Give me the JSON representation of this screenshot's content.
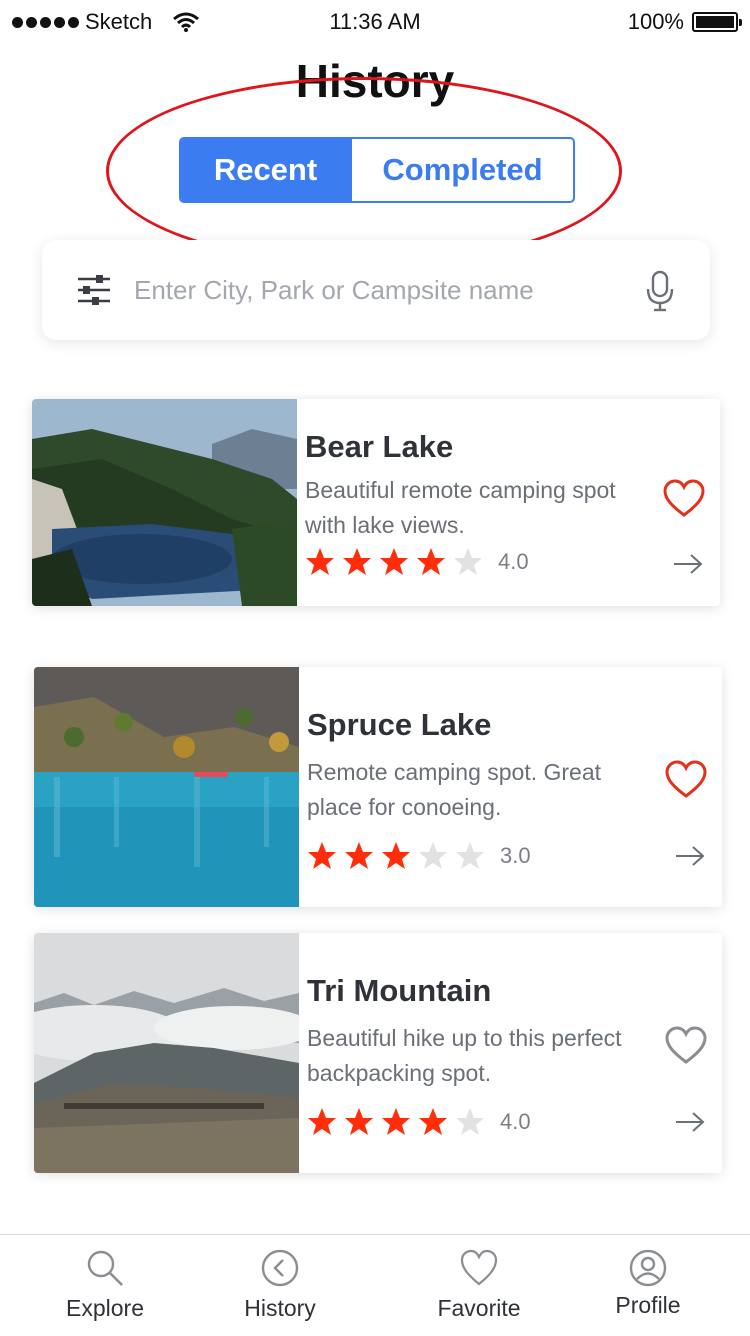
{
  "status_bar": {
    "carrier": "Sketch",
    "time": "11:36 AM",
    "battery": "100%",
    "battery_level": 1.0
  },
  "page": {
    "title": "History"
  },
  "segmented": {
    "recent_label": "Recent",
    "completed_label": "Completed",
    "selected": "Recent"
  },
  "search": {
    "placeholder": "Enter City, Park or Campsite name"
  },
  "colors": {
    "accent": "#3b7cf0",
    "star_filled": "#ff2d0a",
    "star_empty": "#e2e2e2",
    "heart_active": "#e2321c",
    "heart_inactive": "#8a8d92",
    "annotation": "#e0151b"
  },
  "cards": [
    {
      "title": "Bear Lake",
      "description": "Beautiful remote camping spot with lake views.",
      "rating_text": "4.0",
      "rating": 4,
      "favorited": true,
      "icons": [
        "heart-icon",
        "arrow-right-icon"
      ]
    },
    {
      "title": "Spruce Lake",
      "description": "Remote camping spot. Great place for conoeing.",
      "rating_text": "3.0",
      "rating": 3,
      "favorited": true,
      "icons": [
        "heart-icon",
        "arrow-right-icon"
      ]
    },
    {
      "title": "Tri Mountain",
      "description": "Beautiful hike up to this perfect backpacking spot.",
      "rating_text": "4.0",
      "rating": 4,
      "favorited": false,
      "icons": [
        "heart-icon",
        "arrow-right-icon"
      ]
    }
  ],
  "tabbar": {
    "items": [
      {
        "label": "Explore",
        "icon": "search-icon"
      },
      {
        "label": "History",
        "icon": "history-icon"
      },
      {
        "label": "Favorite",
        "icon": "heart-icon"
      },
      {
        "label": "Profile",
        "icon": "profile-icon"
      }
    ]
  }
}
